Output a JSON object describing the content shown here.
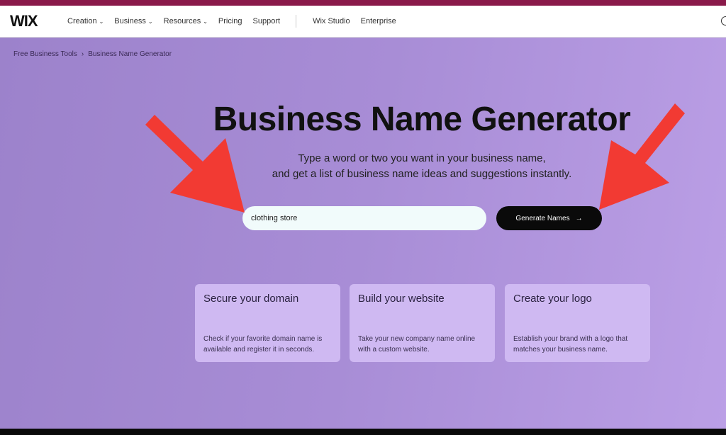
{
  "nav": {
    "logo": "WIX",
    "items": [
      {
        "label": "Creation",
        "dropdown": true
      },
      {
        "label": "Business",
        "dropdown": true
      },
      {
        "label": "Resources",
        "dropdown": true
      },
      {
        "label": "Pricing"
      },
      {
        "label": "Support"
      }
    ],
    "secondary": [
      "Wix Studio",
      "Enterprise"
    ],
    "chevron": "⌄",
    "globe_icon": "globe-icon"
  },
  "breadcrumb": {
    "items": [
      "Free Business Tools",
      "Business Name Generator"
    ],
    "separator": "›"
  },
  "hero": {
    "title": "Business Name Generator",
    "subtitle_line1": "Type a word or two you want in your business name,",
    "subtitle_line2": "and get a list of business name ideas and suggestions instantly.",
    "search_value": "clothing store",
    "button_label": "Generate Names",
    "button_arrow": "→"
  },
  "cards": [
    {
      "title": "Secure your domain",
      "text": "Check if your favorite domain name is available and register it in seconds."
    },
    {
      "title": "Build your website",
      "text": "Take your new company name online with a custom website."
    },
    {
      "title": "Create your logo",
      "text": "Establish your brand with a logo that matches your business name."
    }
  ],
  "colors": {
    "annotation_arrow": "#f23a33",
    "button": "#0a0a0a",
    "topbar": "#8a1a4a"
  }
}
